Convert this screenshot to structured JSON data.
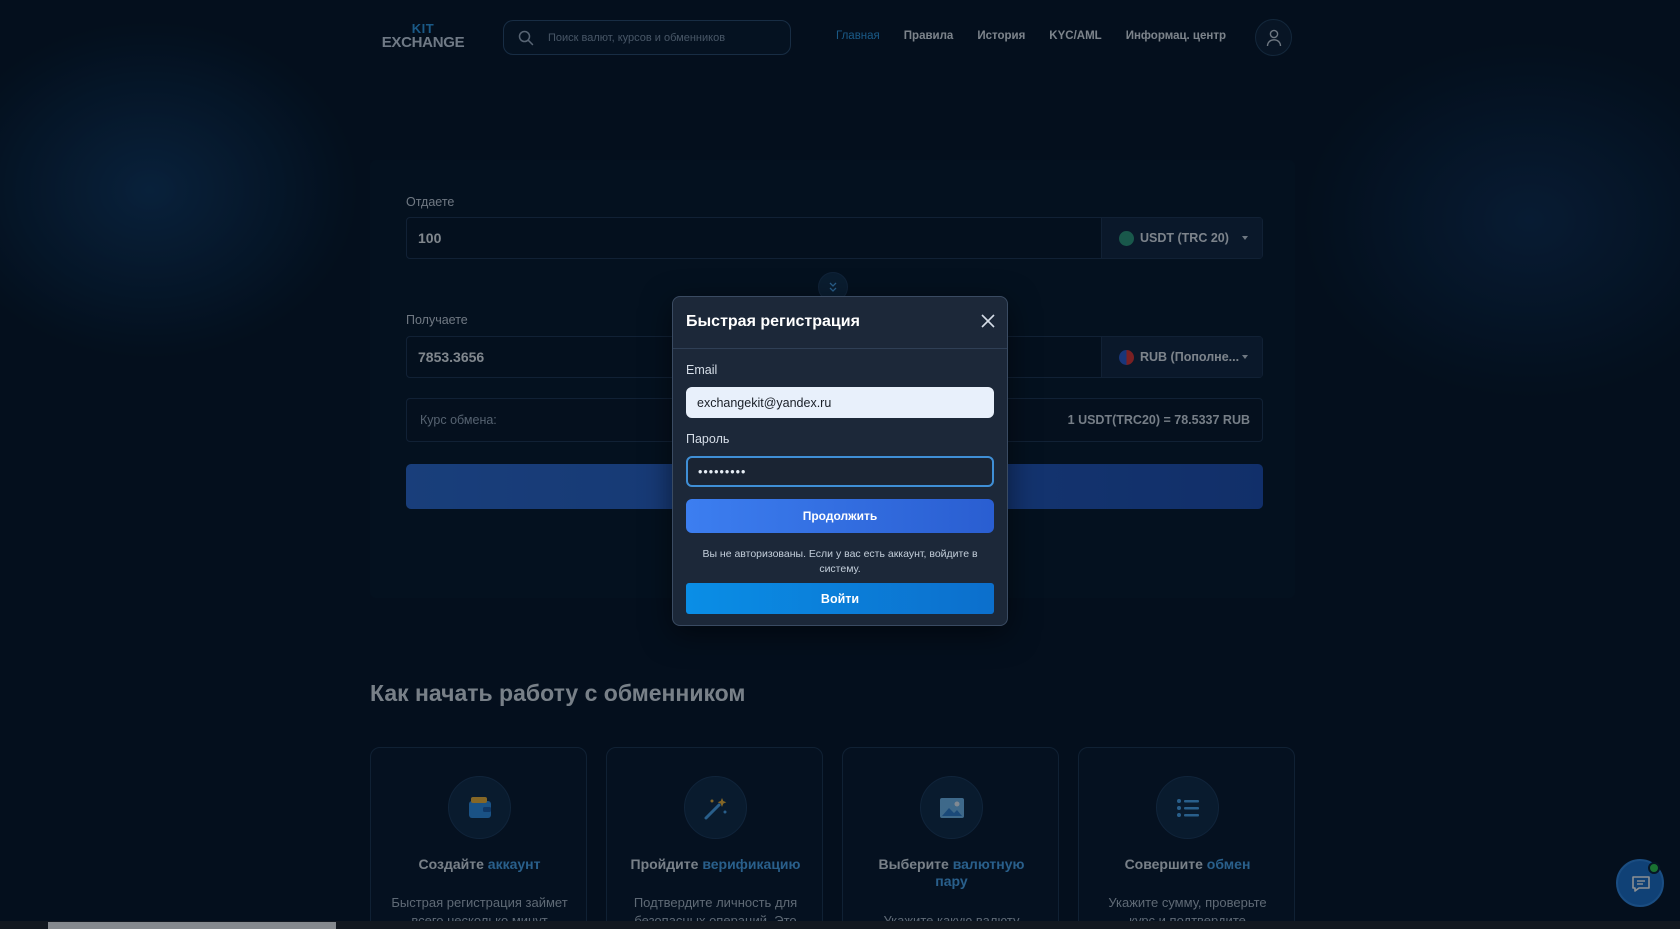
{
  "header": {
    "logo_line1": "KIT",
    "logo_line2": "EXCHANGE",
    "search_placeholder": "Поиск валют, курсов и обменников",
    "nav": [
      {
        "label": "Главная",
        "active": true
      },
      {
        "label": "Правила"
      },
      {
        "label": "История"
      },
      {
        "label": "KYC/AML"
      },
      {
        "label": "Информац. центр"
      }
    ]
  },
  "exchange": {
    "give_label": "Отдаете",
    "give_value": "100",
    "give_currency": "USDT (TRC 20)",
    "receive_label": "Получаете",
    "receive_value": "7853.3656",
    "receive_currency": "RUB (Пополне...",
    "rate_label": "Курс обмена:",
    "rate_value": "1 USDT(TRC20) = 78.5337 RUB"
  },
  "modal": {
    "title": "Быстрая регистрация",
    "email_label": "Email",
    "email_value": "exchangekit@yandex.ru",
    "password_label": "Пароль",
    "password_value": "•••••••••",
    "continue_label": "Продолжить",
    "notice": "Вы не авторизованы. Если у вас есть аккаунт, войдите в систему.",
    "login_label": "Войти"
  },
  "how": {
    "title": "Как начать работу с обменником",
    "steps": [
      {
        "title_plain": "Создайте ",
        "title_accent": "аккаунт",
        "desc": "Быстрая регистрация займет всего несколько минут"
      },
      {
        "title_plain": "Пройдите ",
        "title_accent": "верификацию",
        "desc": "Подтвердите личность для безопасных операций. Это"
      },
      {
        "title_plain": "Выберите ",
        "title_accent": "валютную",
        "title_line2": "пару",
        "desc": "Укажите какую валюту"
      },
      {
        "title_plain": "Совершите ",
        "title_accent": "обмен",
        "desc": "Укажите сумму, проверьте курс и подтвердите"
      }
    ]
  },
  "icons": {
    "search": "search-icon",
    "user": "user-icon",
    "close": "close-icon",
    "swap": "swap-icon",
    "chat": "chat-icon"
  },
  "colors": {
    "accent": "#2f9be8",
    "background": "#061528",
    "primary_button": "#3c7ef0",
    "login_button": "#0a8ee6",
    "online": "#2ecb4f"
  }
}
